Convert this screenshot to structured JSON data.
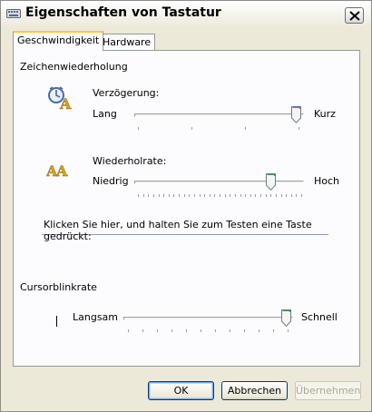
{
  "window": {
    "title": "Eigenschaften von Tastatur"
  },
  "tabs": [
    {
      "label": "Geschwindigkeit",
      "active": true
    },
    {
      "label": "Hardware",
      "active": false
    }
  ],
  "repeat": {
    "group_label": "Zeichenwiederholung",
    "delay": {
      "label": "Verzögerung:",
      "min_label": "Lang",
      "max_label": "Kurz",
      "value_fraction": 1.0,
      "icon": "keyboard-delay-icon"
    },
    "rate": {
      "label": "Wiederholrate:",
      "min_label": "Niedrig",
      "max_label": "Hoch",
      "value_fraction": 0.9,
      "icon": "keyboard-repeat-icon"
    },
    "test_prompt": "Klicken Sie hier, und halten Sie zum Testen eine Taste gedrückt:"
  },
  "cursor": {
    "group_label": "Cursorblinkrate",
    "min_label": "Langsam",
    "max_label": "Schnell",
    "value_fraction": 1.0
  },
  "buttons": {
    "ok": "OK",
    "cancel": "Abbrechen",
    "apply": "Übernehmen"
  },
  "colors": {
    "dialog_bg": "#ece9d8",
    "panel_bg": "#fcfcfe",
    "tab_highlight": "#ffc83c",
    "button_border": "#003c74"
  }
}
